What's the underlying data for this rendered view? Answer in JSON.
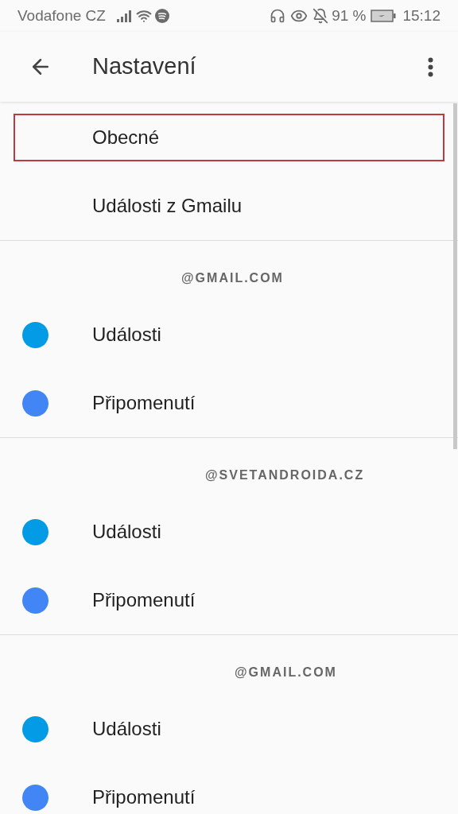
{
  "status_bar": {
    "carrier": "Vodafone CZ",
    "battery": "91 %",
    "time": "15:12"
  },
  "app_bar": {
    "title": "Nastavení"
  },
  "general_items": [
    {
      "label": "Obecné",
      "highlighted": true
    },
    {
      "label": "Události z Gmailu",
      "highlighted": false
    }
  ],
  "accounts": [
    {
      "header": "@GMAIL.COM",
      "calendars": [
        {
          "label": "Události",
          "color": "#039be5"
        },
        {
          "label": "Připomenutí",
          "color": "#4285f4"
        }
      ]
    },
    {
      "header": "@SVETANDROIDA.CZ",
      "calendars": [
        {
          "label": "Události",
          "color": "#039be5"
        },
        {
          "label": "Připomenutí",
          "color": "#4285f4"
        }
      ]
    },
    {
      "header": "@GMAIL.COM",
      "calendars": [
        {
          "label": "Události",
          "color": "#039be5"
        },
        {
          "label": "Připomenutí",
          "color": "#4285f4"
        }
      ]
    }
  ]
}
